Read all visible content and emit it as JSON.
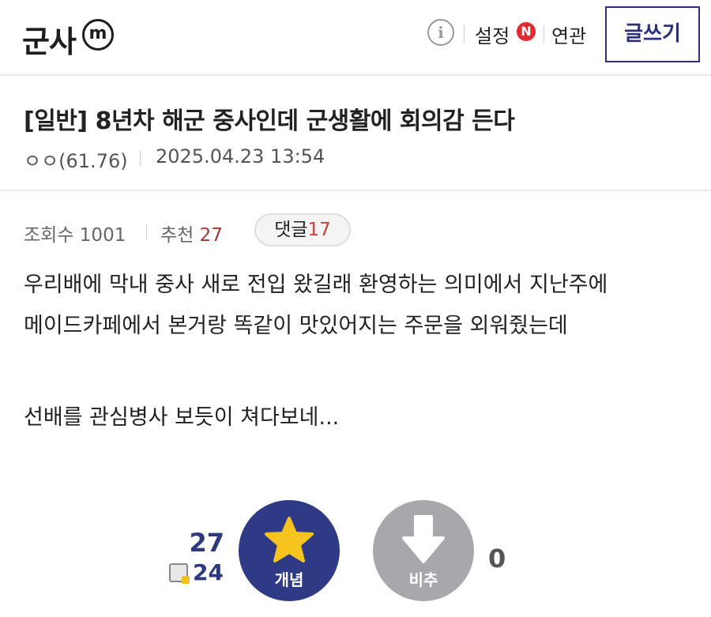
{
  "header": {
    "gallery_title": "군사",
    "minor_badge": "m",
    "info_icon": "i",
    "settings_label": "설정",
    "new_badge": "N",
    "related_label": "연관",
    "write_button": "글쓰기"
  },
  "post": {
    "title": "[일반] 8년차 해군 중사인데 군생활에 회의감 든다",
    "author": "ㅇㅇ(61.76)",
    "date": "2025.04.23 13:54",
    "views_label": "조회수",
    "views": "1001",
    "recommend_label": "추천",
    "recommend": "27",
    "comments_label": "댓글",
    "comments": "17",
    "body_lines": [
      "우리배에 막내 중사 새로 전입 왔길래 환영하는 의미에서 지난주에",
      "메이드카페에서 본거랑 똑같이 맛있어지는 주문을 외워줬는데",
      "선배를 관심병사 보듯이 쳐다보네..."
    ]
  },
  "vote": {
    "up_count": "27",
    "fixed_count": "24",
    "up_label": "개념",
    "down_label": "비추",
    "down_count": "0"
  },
  "colors": {
    "brand_navy": "#2e3a85",
    "accent_red": "#c8403a",
    "down_gray": "#a8a8ac"
  }
}
